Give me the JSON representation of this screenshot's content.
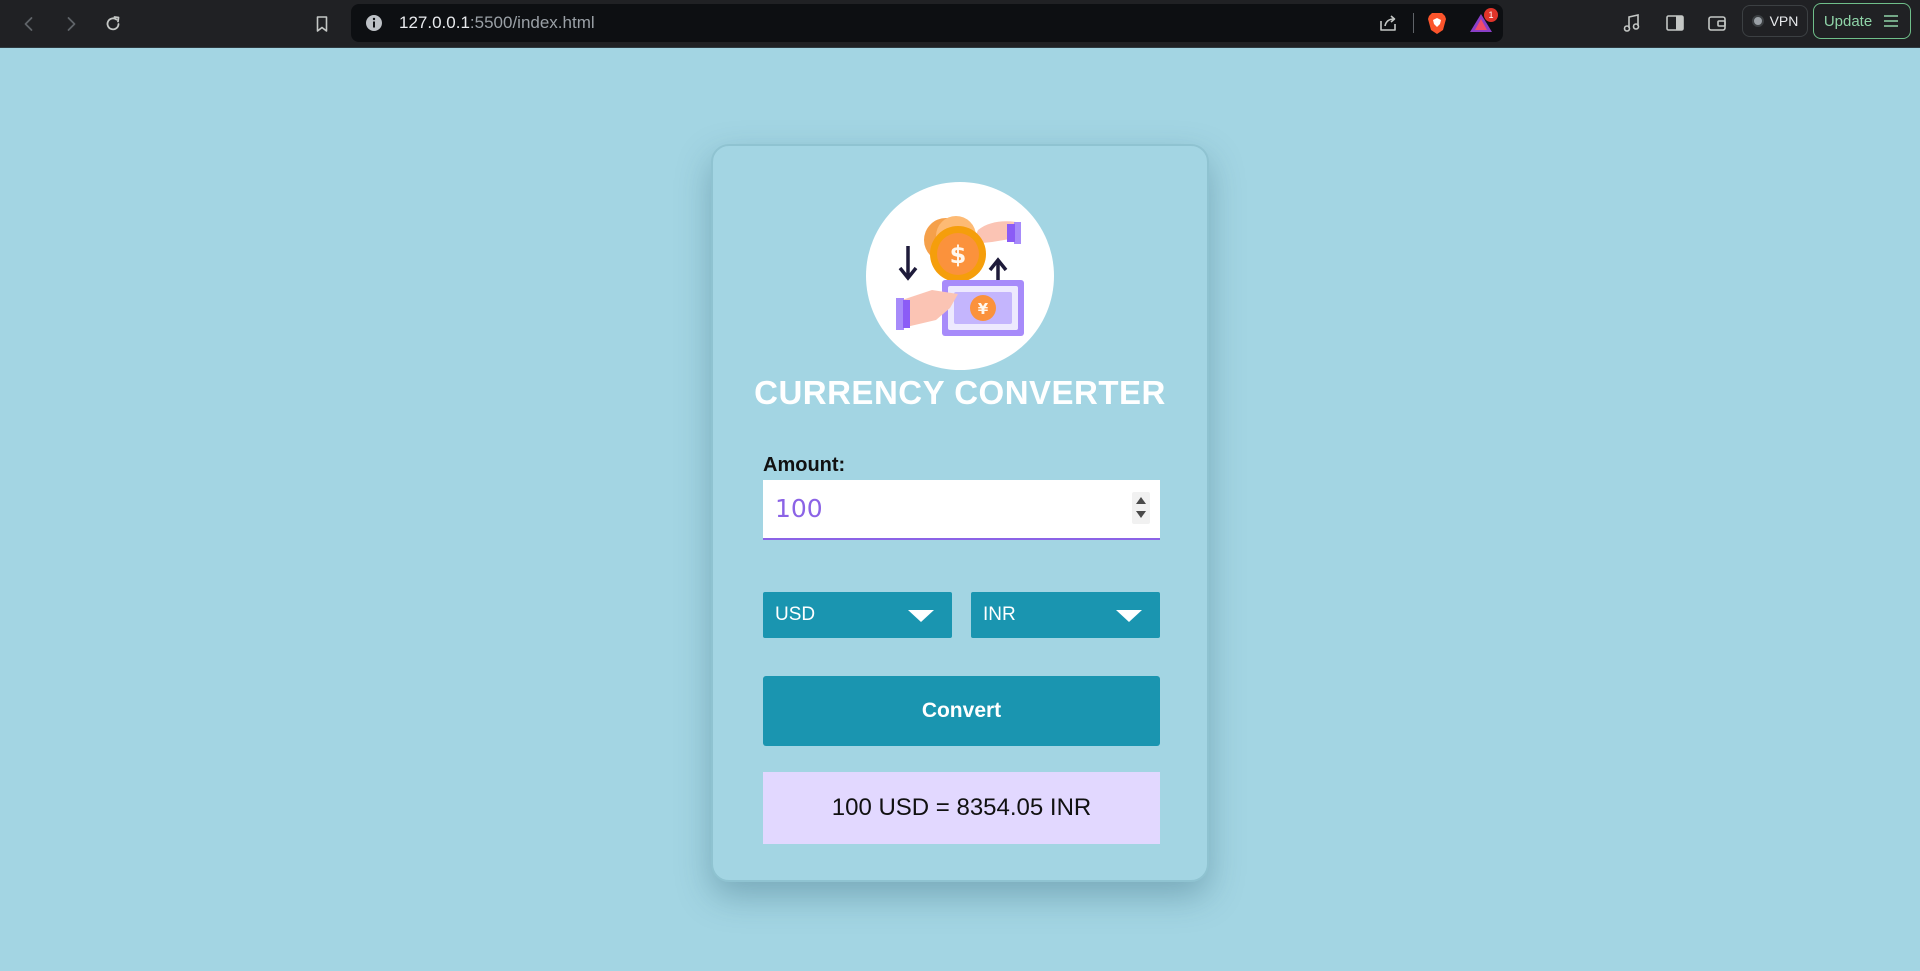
{
  "browser": {
    "url_host": "127.0.0.1",
    "url_rest": ":5500/index.html",
    "rewards_count": "1",
    "vpn_label": "VPN",
    "update_label": "Update",
    "icons": [
      "back-icon",
      "forward-icon",
      "reload-icon",
      "bookmark-icon",
      "info-icon",
      "share-icon",
      "brave-shields-icon",
      "brave-rewards-icon",
      "music-icon",
      "sidebar-icon",
      "wallet-icon",
      "menu-icon"
    ]
  },
  "app": {
    "title": "CURRENCY CONVERTER",
    "amount_label": "Amount:",
    "amount_value": "100",
    "from_currency": "USD",
    "to_currency": "INR",
    "convert_label": "Convert",
    "result_text": "100 USD = 8354.05 INR",
    "logo_icon": "currency-exchange-icon"
  },
  "colors": {
    "page_background": "#a3d5e3",
    "accent": "#1a95b0",
    "input_text": "#8b63e6",
    "result_background": "#e2d8ff"
  }
}
